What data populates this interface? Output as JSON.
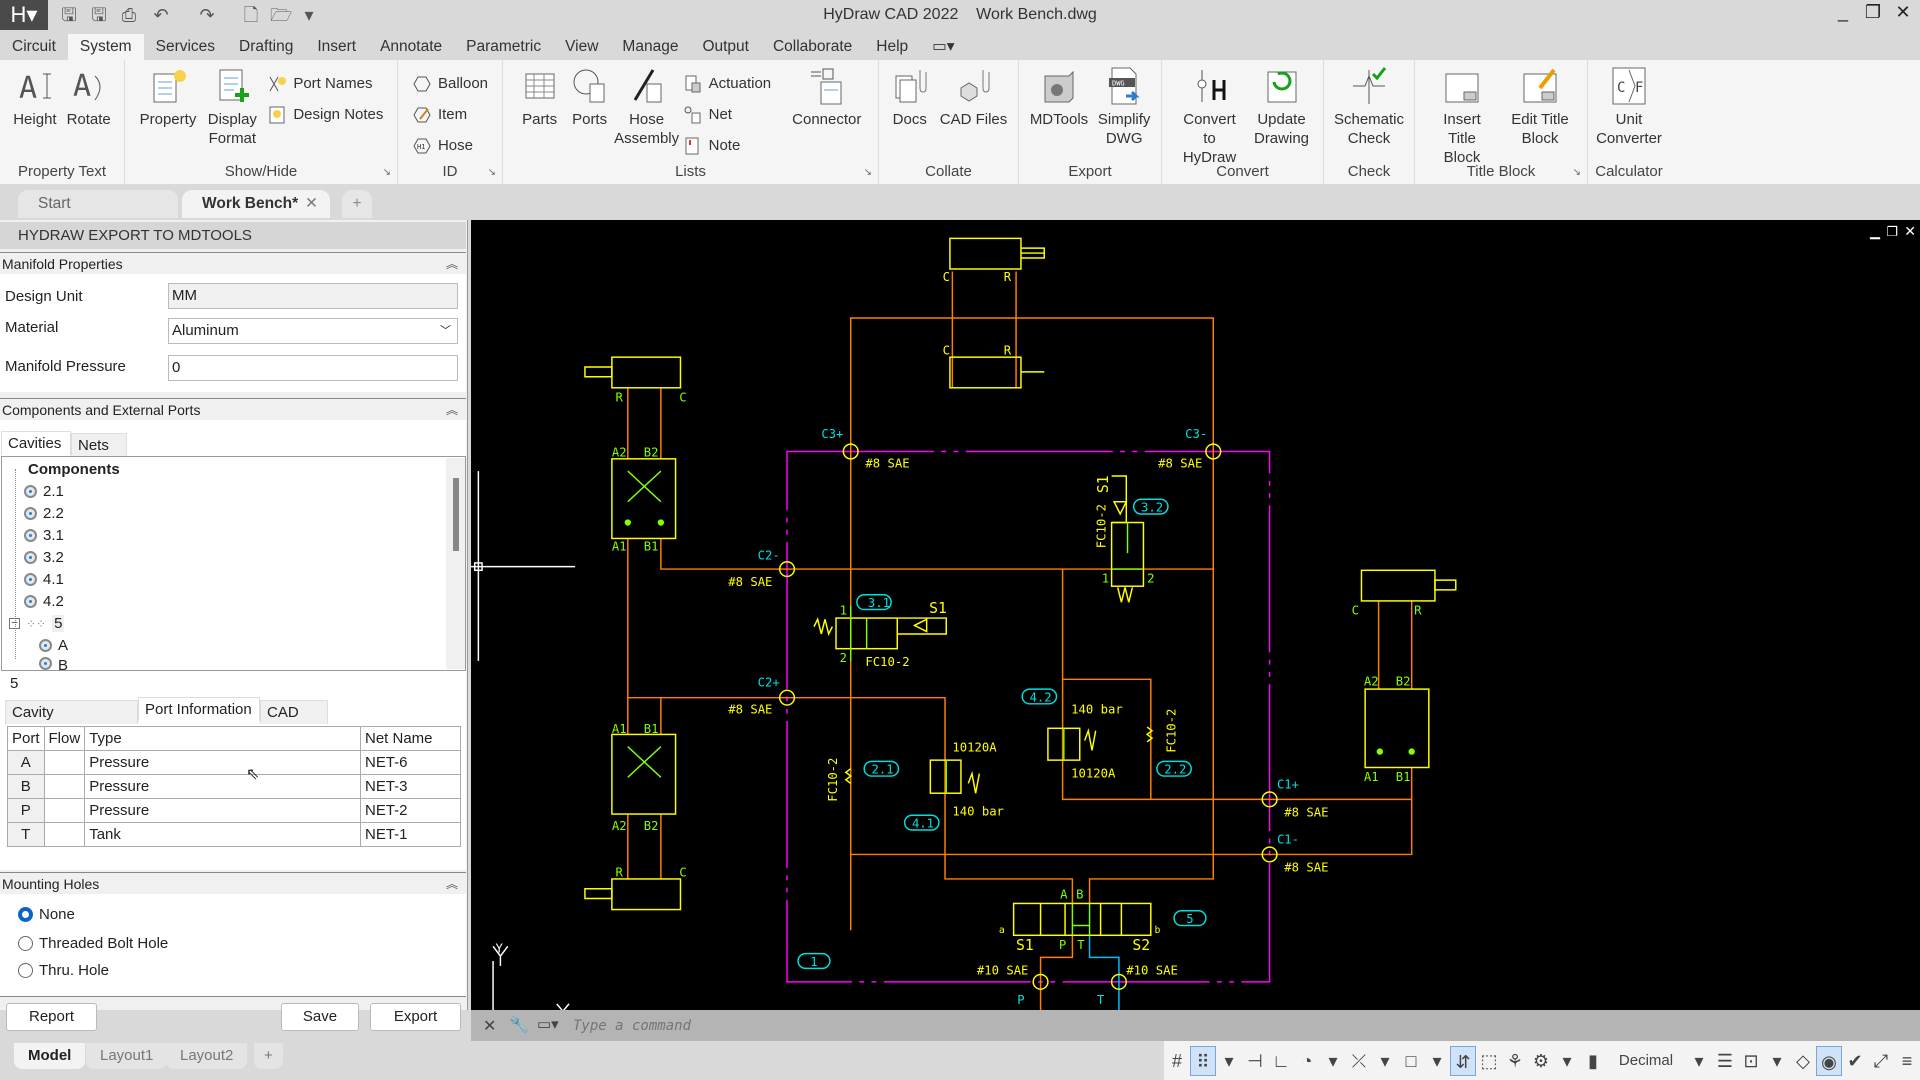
{
  "titlebar": {
    "title": "HyDraw CAD 2022    Work Bench.dwg"
  },
  "menu": [
    "Circuit",
    "System",
    "Services",
    "Drafting",
    "Insert",
    "Annotate",
    "Parametric",
    "View",
    "Manage",
    "Output",
    "Collaborate",
    "Help"
  ],
  "ribbon": {
    "property_text": {
      "label": "Property Text",
      "height": "Height",
      "rotate": "Rotate"
    },
    "show_hide": {
      "label": "Show/Hide",
      "property": "Property",
      "display_format": "Display Format",
      "port_names": "Port Names",
      "design_notes": "Design Notes"
    },
    "id": {
      "label": "ID",
      "balloon": "Balloon",
      "item": "Item",
      "hose": "Hose"
    },
    "lists": {
      "label": "Lists",
      "parts": "Parts",
      "ports": "Ports",
      "hose_assembly": "Hose Assembly",
      "actuation": "Actuation",
      "net": "Net",
      "note": "Note",
      "connector": "Connector"
    },
    "collate": {
      "label": "Collate",
      "docs": "Docs",
      "cad_files": "CAD Files"
    },
    "export": {
      "label": "Export",
      "mdtools": "MDTools",
      "simplify_dwg": "Simplify DWG"
    },
    "convert": {
      "label": "Convert",
      "convert_to_hydraw": "Convert to HyDraw",
      "update_drawing": "Update Drawing"
    },
    "check": {
      "label": "Check",
      "schematic_check": "Schematic Check"
    },
    "title_block": {
      "label": "Title Block",
      "insert": "Insert Title Block",
      "edit": "Edit Title Block"
    },
    "calculator": {
      "label": "Calculator",
      "unit_converter": "Unit Converter"
    }
  },
  "doc_tabs": [
    {
      "label": "Start"
    },
    {
      "label": "Work Bench*"
    }
  ],
  "panel": {
    "title": "HYDRAW EXPORT TO MDTOOLS",
    "manifold": {
      "header": "Manifold Properties",
      "design_unit_label": "Design Unit",
      "design_unit": "MM",
      "material_label": "Material",
      "material": "Aluminum",
      "pressure_label": "Manifold Pressure",
      "pressure": "0"
    },
    "components": {
      "header": "Components and External Ports",
      "tabs": [
        "Cavities",
        "Nets"
      ],
      "tree_root": "Components",
      "items": [
        "2.1",
        "2.2",
        "3.1",
        "3.2",
        "4.1",
        "4.2"
      ],
      "group": "5",
      "children": [
        "A",
        "B"
      ],
      "selected": "5"
    },
    "info_tabs": [
      "Cavity Information",
      "Port Information",
      "CAD Files"
    ],
    "port_table": {
      "headers": [
        "Port",
        "Flow",
        "Type",
        "Net Name"
      ],
      "rows": [
        [
          "A",
          "",
          "Pressure",
          "NET-6"
        ],
        [
          "B",
          "",
          "Pressure",
          "NET-3"
        ],
        [
          "P",
          "",
          "Pressure",
          "NET-2"
        ],
        [
          "T",
          "",
          "Tank",
          "NET-1"
        ]
      ]
    },
    "mounting": {
      "header": "Mounting Holes",
      "options": [
        "None",
        "Threaded Bolt Hole",
        "Thru. Hole"
      ],
      "selected": "None"
    },
    "buttons": {
      "report": "Report",
      "save": "Save",
      "export": "Export"
    }
  },
  "drawing": {
    "ports": {
      "c3p": "C3+",
      "c3m": "C3-",
      "c2m": "C2-",
      "c2p": "C2+",
      "c1p": "C1+",
      "c1m": "C1-",
      "p": "P",
      "t": "T"
    },
    "sae8": "#8 SAE",
    "sae10": "#10 SAE",
    "balloons": [
      "3.1",
      "3.2",
      "4.2",
      "2.1",
      "2.2",
      "4.1",
      "1",
      "5"
    ],
    "labels": {
      "fc": "FC10-2",
      "s1": "S1",
      "s2": "S2",
      "bar": "140 bar",
      "relief": "10120A",
      "c": "C",
      "r": "R",
      "a1": "A1",
      "a2": "A2",
      "b1": "B1",
      "b2": "B2",
      "a": "A",
      "b": "B",
      "pp": "P",
      "tt": "T",
      "one": "1",
      "two": "2",
      "sa": "a",
      "sb": "b",
      "y": "Y",
      "x": "X"
    },
    "colors": {
      "lines": "#ff8000",
      "manifold": "#ff00ff",
      "symbols": "#ffff00",
      "ports_text": "#00e0e0",
      "internal": "#80ff00",
      "tank": "#00bfff"
    }
  },
  "command": {
    "placeholder": "Type a command"
  },
  "layout_tabs": [
    "Model",
    "Layout1",
    "Layout2"
  ],
  "status": {
    "units": "Decimal"
  }
}
